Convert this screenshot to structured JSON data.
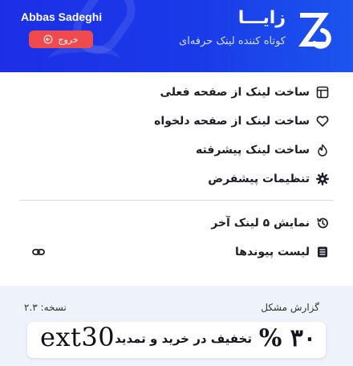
{
  "header": {
    "brand": "زایـــا",
    "tagline": "کوتاه کننده لینک حرفه‌ای",
    "username": "Abbas Sadeghi",
    "logout_label": "خروج",
    "colors": {
      "bg_start": "#1d2fe6",
      "bg_end": "#1c54ee",
      "logout_bg": "#ef4b4f"
    }
  },
  "menu": {
    "items": [
      {
        "label": "ساخت لینک از صفحه فعلی",
        "icon": "layout-icon"
      },
      {
        "label": "ساخت لینک از صفحه دلخواه",
        "icon": "heart-icon"
      },
      {
        "label": "ساخت لینک پیشرفته",
        "icon": "flame-icon"
      },
      {
        "label": "تنظیمات پیشفرض",
        "icon": "gear-icon"
      },
      {
        "label": "نمایش ۵ لینک آخر",
        "icon": "history-icon"
      },
      {
        "label": "لیست پیوندها",
        "icon": "list-icon"
      }
    ]
  },
  "footer": {
    "report_label": "گزارش مشکل",
    "version_label": "نسخه: ۲.۳",
    "promo": {
      "percent": "۳۰ %",
      "text": "تخفیف در خرید و تمدید",
      "code": "ext30"
    }
  }
}
